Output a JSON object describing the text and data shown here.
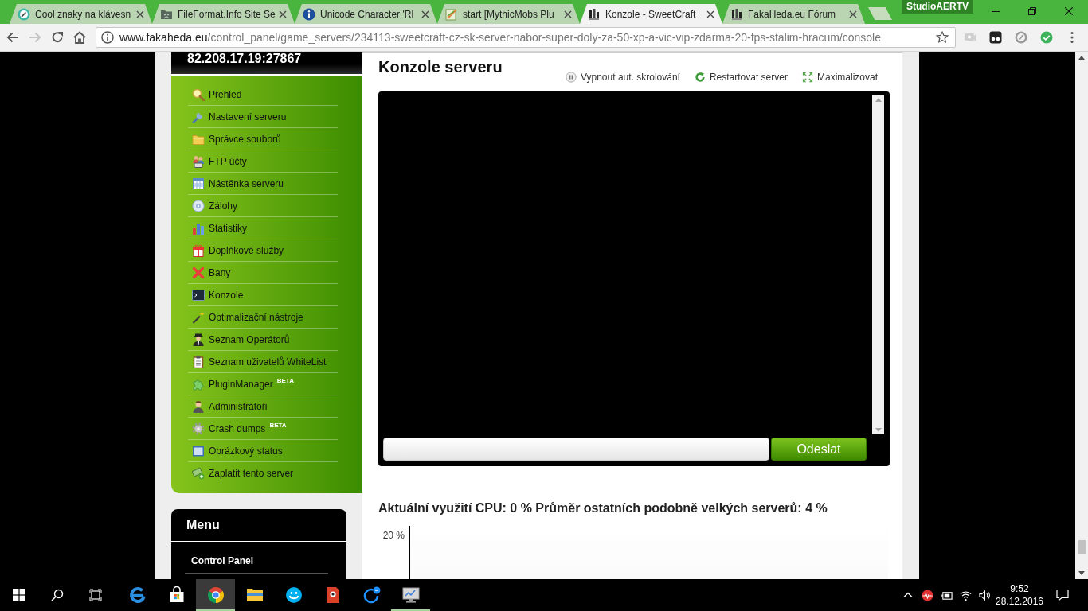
{
  "browser": {
    "tabs": [
      {
        "title": "Cool znaky na klávesn",
        "selected": false
      },
      {
        "title": "FileFormat.Info Site Se",
        "selected": false
      },
      {
        "title": "Unicode Character 'RI",
        "selected": false
      },
      {
        "title": "start [MythicMobs Plu",
        "selected": false
      },
      {
        "title": "Konzole - SweetCraft",
        "selected": true
      },
      {
        "title": "FakaHeda.eu Fórum",
        "selected": false
      }
    ],
    "profile_name": "StudioAERTV",
    "navigation": {
      "back": {
        "disabled": false
      },
      "forward": {
        "disabled": true
      }
    },
    "url": {
      "host": "www.fakaheda.eu",
      "path": "/control_panel/game_servers/234113-sweetcraft-cz-sk-server-nabor-super-doly-za-50-xp-a-vic-vip-zdarma-20-fps-stalim-hracum/console"
    }
  },
  "page": {
    "server_address": "82.208.17.19:27867",
    "sidebar": {
      "items": [
        {
          "label": "Přehled"
        },
        {
          "label": "Nastavení serveru"
        },
        {
          "label": "Správce souborů"
        },
        {
          "label": "FTP účty"
        },
        {
          "label": "Nástěnka serveru"
        },
        {
          "label": "Zálohy"
        },
        {
          "label": "Statistiky"
        },
        {
          "label": "Doplňkové služby"
        },
        {
          "label": "Bany"
        },
        {
          "label": "Konzole"
        },
        {
          "label": "Optimalizační nástroje"
        },
        {
          "label": "Seznam Operátorů"
        },
        {
          "label": "Seznam uživatelů WhiteList"
        },
        {
          "label": "PluginManager",
          "badge": "BETA"
        },
        {
          "label": "Administrátoři"
        },
        {
          "label": "Crash dumps",
          "badge": "BETA"
        },
        {
          "label": "Obrázkový status"
        },
        {
          "label": "Zaplatit tento server"
        }
      ]
    },
    "menu": {
      "title": "Menu",
      "items": [
        "Control Panel"
      ]
    },
    "console": {
      "title": "Konzole serveru",
      "actions": [
        {
          "label": "Vypnout aut. skrolování"
        },
        {
          "label": "Restartovat server"
        },
        {
          "label": "Maximalizovat"
        }
      ],
      "send_button": "Odeslat"
    },
    "cpu": {
      "summary": "Aktuální využití CPU: 0 % Průměr ostatních podobně velkých serverů: 4 %",
      "chart_y_label": "20 %"
    }
  },
  "taskbar": {
    "apps": [
      {
        "running": false,
        "selected": false
      },
      {
        "running": false,
        "selected": false
      },
      {
        "running": true,
        "selected": true
      },
      {
        "running": false,
        "selected": false
      },
      {
        "running": false,
        "selected": false
      },
      {
        "running": false,
        "selected": false
      },
      {
        "running": false,
        "selected": false
      },
      {
        "running": true,
        "selected": false
      }
    ],
    "time": "9:52",
    "date": "28.12.2016"
  }
}
